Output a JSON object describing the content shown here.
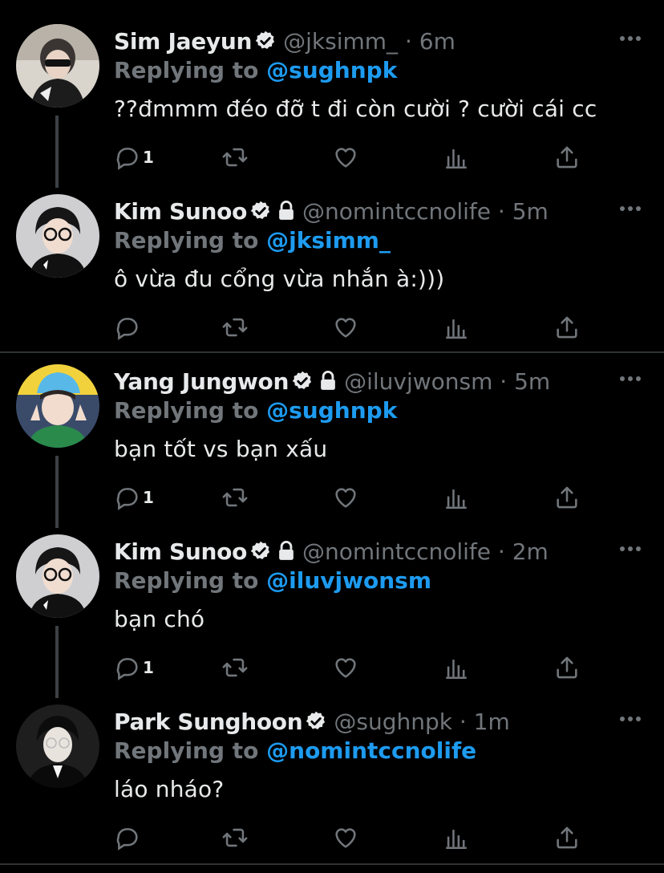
{
  "colors": {
    "background": "#000000",
    "text": "#e7e9ea",
    "muted": "#71767b",
    "link": "#1d9bf0",
    "divider": "#2f3336"
  },
  "replying_prefix": "Replying to",
  "tweets": [
    {
      "name": "Sim Jaeyun",
      "handle": "@jksimm_",
      "sep": "·",
      "time": "6m",
      "reply_to": "@sughnpk",
      "text": "??đmmm đéo đỡ t đi còn cười ? cười cái cc",
      "reply_count": "1",
      "verified": true,
      "locked": false,
      "avatar_icon": "avatar-sim-jaeyun"
    },
    {
      "name": "Kim Sunoo",
      "handle": "@nomintccnolife",
      "sep": "·",
      "time": "5m",
      "reply_to": "@jksimm_",
      "text": "ô vừa đu cổng vừa nhắn à:)))",
      "reply_count": "",
      "verified": true,
      "locked": true,
      "avatar_icon": "avatar-kim-sunoo"
    },
    {
      "name": "Yang Jungwon",
      "handle": "@iluvjwonsm",
      "sep": "·",
      "time": "5m",
      "reply_to": "@sughnpk",
      "text": "bạn tốt vs bạn xấu",
      "reply_count": "1",
      "verified": true,
      "locked": true,
      "avatar_icon": "avatar-yang-jungwon"
    },
    {
      "name": "Kim Sunoo",
      "handle": "@nomintccnolife",
      "sep": "·",
      "time": "2m",
      "reply_to": "@iluvjwonsm",
      "text": "bạn chó",
      "reply_count": "1",
      "verified": true,
      "locked": true,
      "avatar_icon": "avatar-kim-sunoo"
    },
    {
      "name": "Park Sunghoon",
      "handle": "@sughnpk",
      "sep": "·",
      "time": "1m",
      "reply_to": "@nomintccnolife",
      "text": "láo nháo?",
      "reply_count": "",
      "verified": true,
      "locked": false,
      "avatar_icon": "avatar-park-sunghoon"
    }
  ]
}
